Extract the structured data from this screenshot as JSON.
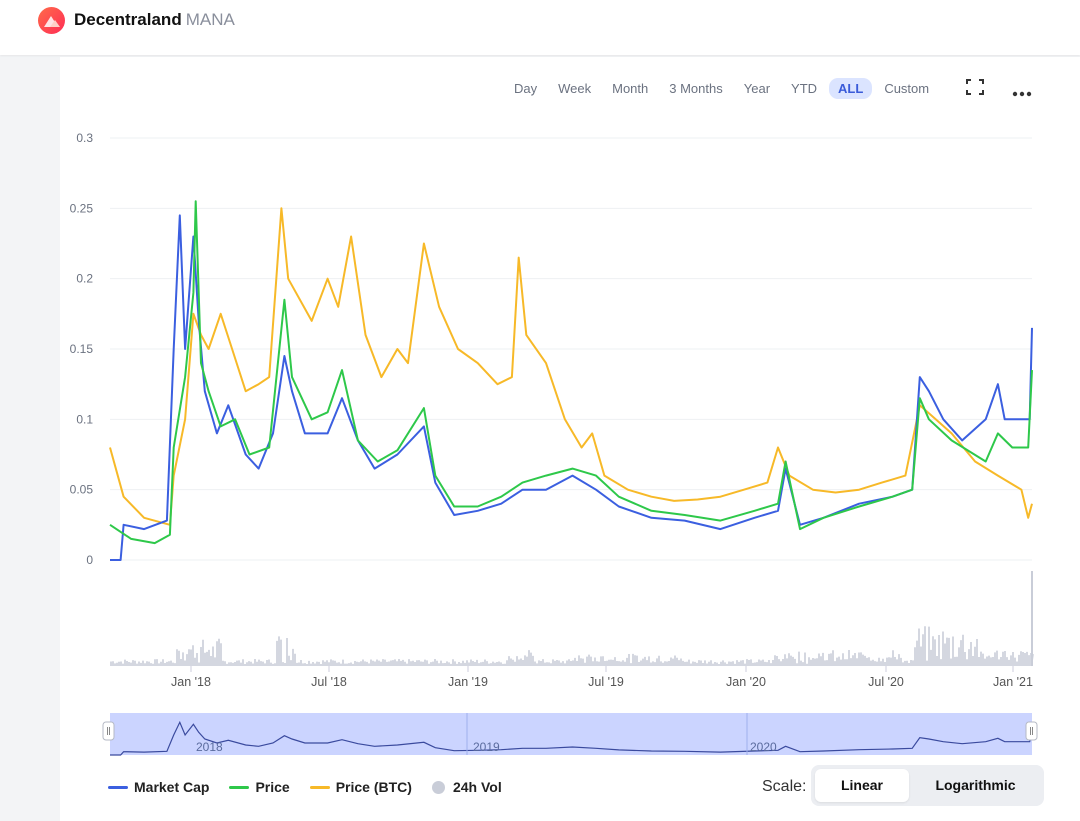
{
  "header": {
    "name": "Decentraland",
    "ticker": "MANA"
  },
  "range_buttons": [
    "Day",
    "Week",
    "Month",
    "3 Months",
    "Year",
    "YTD",
    "ALL",
    "Custom"
  ],
  "active_range": "ALL",
  "toolbar": {
    "fullscreen_icon": "fullscreen-icon",
    "more_icon": "more-dots-icon"
  },
  "colors": {
    "market_cap": "#3b5fe0",
    "price": "#2ec84a",
    "price_btc": "#f7b928",
    "volume": "#c9cdd8",
    "navigator": "#b9c6ff"
  },
  "legend": {
    "market_cap": "Market Cap",
    "price": "Price",
    "price_btc": "Price (BTC)",
    "vol": "24h Vol"
  },
  "scale": {
    "label": "Scale:",
    "linear": "Linear",
    "logarithmic": "Logarithmic",
    "active": "Linear"
  },
  "chart_data": {
    "type": "line",
    "y_ticks": [
      "0.3",
      "0.25",
      "0.2",
      "0.15",
      "0.1",
      "0.05",
      "0"
    ],
    "x_ticks": [
      "Jan '18",
      "Jul '18",
      "Jan '19",
      "Jul '19",
      "Jan '20",
      "Jul '20",
      "Jan '21"
    ],
    "navigator_labels": [
      "2018",
      "2019",
      "2020"
    ],
    "ylim": [
      0,
      0.3
    ],
    "series": [
      {
        "name": "Market Cap",
        "points": [
          [
            "2017-09-17",
            0
          ],
          [
            "2017-10-01",
            0
          ],
          [
            "2017-10-05",
            0.025
          ],
          [
            "2017-11-01",
            0.022
          ],
          [
            "2017-12-01",
            0.028
          ],
          [
            "2017-12-10",
            0.15
          ],
          [
            "2017-12-18",
            0.245
          ],
          [
            "2017-12-25",
            0.15
          ],
          [
            "2018-01-05",
            0.23
          ],
          [
            "2018-01-12",
            0.17
          ],
          [
            "2018-01-20",
            0.12
          ],
          [
            "2018-02-05",
            0.09
          ],
          [
            "2018-02-20",
            0.11
          ],
          [
            "2018-03-15",
            0.075
          ],
          [
            "2018-04-01",
            0.065
          ],
          [
            "2018-04-20",
            0.09
          ],
          [
            "2018-05-05",
            0.145
          ],
          [
            "2018-05-15",
            0.12
          ],
          [
            "2018-06-01",
            0.09
          ],
          [
            "2018-07-01",
            0.09
          ],
          [
            "2018-07-20",
            0.115
          ],
          [
            "2018-08-10",
            0.085
          ],
          [
            "2018-09-01",
            0.065
          ],
          [
            "2018-10-01",
            0.075
          ],
          [
            "2018-11-05",
            0.095
          ],
          [
            "2018-11-20",
            0.055
          ],
          [
            "2018-12-15",
            0.032
          ],
          [
            "2019-01-15",
            0.035
          ],
          [
            "2019-02-15",
            0.04
          ],
          [
            "2019-03-15",
            0.05
          ],
          [
            "2019-04-15",
            0.05
          ],
          [
            "2019-05-20",
            0.06
          ],
          [
            "2019-06-20",
            0.05
          ],
          [
            "2019-07-20",
            0.038
          ],
          [
            "2019-09-01",
            0.03
          ],
          [
            "2019-10-15",
            0.028
          ],
          [
            "2019-12-01",
            0.022
          ],
          [
            "2020-01-15",
            0.03
          ],
          [
            "2020-02-15",
            0.035
          ],
          [
            "2020-02-25",
            0.065
          ],
          [
            "2020-03-15",
            0.025
          ],
          [
            "2020-04-15",
            0.03
          ],
          [
            "2020-06-01",
            0.04
          ],
          [
            "2020-07-15",
            0.045
          ],
          [
            "2020-08-10",
            0.05
          ],
          [
            "2020-08-20",
            0.13
          ],
          [
            "2020-09-01",
            0.12
          ],
          [
            "2020-09-20",
            0.1
          ],
          [
            "2020-10-15",
            0.085
          ],
          [
            "2020-11-15",
            0.1
          ],
          [
            "2020-12-01",
            0.125
          ],
          [
            "2020-12-10",
            0.1
          ],
          [
            "2021-01-01",
            0.1
          ],
          [
            "2021-01-12",
            0.1
          ],
          [
            "2021-01-15",
            0.165
          ]
        ]
      },
      {
        "name": "Price",
        "points": [
          [
            "2017-09-17",
            0.025
          ],
          [
            "2017-10-15",
            0.015
          ],
          [
            "2017-11-15",
            0.012
          ],
          [
            "2017-12-05",
            0.018
          ],
          [
            "2017-12-10",
            0.08
          ],
          [
            "2017-12-25",
            0.13
          ],
          [
            "2018-01-05",
            0.19
          ],
          [
            "2018-01-08",
            0.255
          ],
          [
            "2018-01-15",
            0.14
          ],
          [
            "2018-01-25",
            0.12
          ],
          [
            "2018-02-10",
            0.095
          ],
          [
            "2018-03-01",
            0.1
          ],
          [
            "2018-03-20",
            0.075
          ],
          [
            "2018-04-15",
            0.08
          ],
          [
            "2018-05-05",
            0.185
          ],
          [
            "2018-05-15",
            0.13
          ],
          [
            "2018-06-10",
            0.1
          ],
          [
            "2018-07-01",
            0.105
          ],
          [
            "2018-07-20",
            0.135
          ],
          [
            "2018-08-10",
            0.085
          ],
          [
            "2018-09-05",
            0.07
          ],
          [
            "2018-10-01",
            0.078
          ],
          [
            "2018-11-05",
            0.108
          ],
          [
            "2018-11-20",
            0.06
          ],
          [
            "2018-12-15",
            0.038
          ],
          [
            "2019-01-15",
            0.038
          ],
          [
            "2019-02-15",
            0.045
          ],
          [
            "2019-03-15",
            0.055
          ],
          [
            "2019-04-15",
            0.06
          ],
          [
            "2019-05-20",
            0.065
          ],
          [
            "2019-06-20",
            0.06
          ],
          [
            "2019-07-20",
            0.045
          ],
          [
            "2019-09-01",
            0.035
          ],
          [
            "2019-10-15",
            0.032
          ],
          [
            "2019-12-01",
            0.028
          ],
          [
            "2020-01-15",
            0.035
          ],
          [
            "2020-02-15",
            0.04
          ],
          [
            "2020-02-25",
            0.07
          ],
          [
            "2020-03-15",
            0.022
          ],
          [
            "2020-04-15",
            0.03
          ],
          [
            "2020-06-01",
            0.038
          ],
          [
            "2020-07-15",
            0.045
          ],
          [
            "2020-08-10",
            0.05
          ],
          [
            "2020-08-20",
            0.115
          ],
          [
            "2020-09-01",
            0.1
          ],
          [
            "2020-10-01",
            0.085
          ],
          [
            "2020-11-15",
            0.07
          ],
          [
            "2020-12-01",
            0.09
          ],
          [
            "2020-12-20",
            0.08
          ],
          [
            "2021-01-10",
            0.08
          ],
          [
            "2021-01-15",
            0.135
          ]
        ]
      },
      {
        "name": "Price (BTC)",
        "points": [
          [
            "2017-09-17",
            0.08
          ],
          [
            "2017-10-05",
            0.045
          ],
          [
            "2017-11-01",
            0.03
          ],
          [
            "2017-12-05",
            0.025
          ],
          [
            "2017-12-10",
            0.06
          ],
          [
            "2017-12-25",
            0.1
          ],
          [
            "2018-01-05",
            0.175
          ],
          [
            "2018-01-15",
            0.16
          ],
          [
            "2018-01-25",
            0.15
          ],
          [
            "2018-02-10",
            0.175
          ],
          [
            "2018-02-25",
            0.15
          ],
          [
            "2018-03-15",
            0.12
          ],
          [
            "2018-04-01",
            0.125
          ],
          [
            "2018-04-15",
            0.13
          ],
          [
            "2018-05-01",
            0.25
          ],
          [
            "2018-05-10",
            0.2
          ],
          [
            "2018-06-10",
            0.17
          ],
          [
            "2018-07-01",
            0.2
          ],
          [
            "2018-07-15",
            0.18
          ],
          [
            "2018-08-01",
            0.23
          ],
          [
            "2018-08-20",
            0.16
          ],
          [
            "2018-09-10",
            0.13
          ],
          [
            "2018-10-01",
            0.15
          ],
          [
            "2018-10-15",
            0.14
          ],
          [
            "2018-11-05",
            0.225
          ],
          [
            "2018-11-25",
            0.18
          ],
          [
            "2018-12-20",
            0.15
          ],
          [
            "2019-01-15",
            0.14
          ],
          [
            "2019-02-10",
            0.125
          ],
          [
            "2019-03-01",
            0.13
          ],
          [
            "2019-03-10",
            0.215
          ],
          [
            "2019-03-20",
            0.16
          ],
          [
            "2019-04-15",
            0.14
          ],
          [
            "2019-05-10",
            0.1
          ],
          [
            "2019-06-01",
            0.08
          ],
          [
            "2019-06-15",
            0.09
          ],
          [
            "2019-07-01",
            0.06
          ],
          [
            "2019-08-01",
            0.05
          ],
          [
            "2019-09-01",
            0.045
          ],
          [
            "2019-10-01",
            0.042
          ],
          [
            "2019-11-01",
            0.043
          ],
          [
            "2019-12-01",
            0.045
          ],
          [
            "2020-01-01",
            0.05
          ],
          [
            "2020-02-01",
            0.055
          ],
          [
            "2020-02-15",
            0.08
          ],
          [
            "2020-03-01",
            0.06
          ],
          [
            "2020-04-01",
            0.05
          ],
          [
            "2020-05-01",
            0.048
          ],
          [
            "2020-06-01",
            0.05
          ],
          [
            "2020-07-01",
            0.055
          ],
          [
            "2020-08-01",
            0.06
          ],
          [
            "2020-08-20",
            0.11
          ],
          [
            "2020-09-10",
            0.1
          ],
          [
            "2020-10-01",
            0.09
          ],
          [
            "2020-11-01",
            0.07
          ],
          [
            "2020-12-01",
            0.06
          ],
          [
            "2021-01-01",
            0.05
          ],
          [
            "2021-01-10",
            0.03
          ],
          [
            "2021-01-15",
            0.04
          ]
        ]
      }
    ]
  }
}
